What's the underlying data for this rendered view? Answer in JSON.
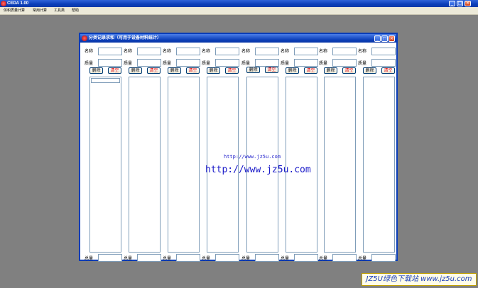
{
  "app": {
    "title": "CEDA 1.00"
  },
  "menu": [
    "体积质量计算",
    "常用计算",
    "工具类",
    "帮助"
  ],
  "dialog": {
    "title": "分类记录求和（可用于设备材料统计）",
    "columns": [
      {
        "name_label": "名称",
        "name_value": "",
        "mass_label": "质量",
        "mass_value": "",
        "delete_label": "删除",
        "clear_label": "清空",
        "total_label": "总量",
        "total_value": "",
        "has_selection": true
      },
      {
        "name_label": "名称",
        "name_value": "",
        "mass_label": "质量",
        "mass_value": "",
        "delete_label": "删除",
        "clear_label": "清空",
        "total_label": "总量",
        "total_value": "",
        "has_selection": false
      },
      {
        "name_label": "名称",
        "name_value": "",
        "mass_label": "质量",
        "mass_value": "",
        "delete_label": "删除",
        "clear_label": "清空",
        "total_label": "总量",
        "total_value": "",
        "has_selection": false
      },
      {
        "name_label": "名称",
        "name_value": "",
        "mass_label": "质量",
        "mass_value": "",
        "delete_label": "删除",
        "clear_label": "清空",
        "total_label": "总量",
        "total_value": "",
        "has_selection": false
      },
      {
        "name_label": "名称",
        "name_value": "",
        "mass_label": "质量",
        "mass_value": "",
        "delete_label": "删除",
        "clear_label": "清空",
        "total_label": "总量",
        "total_value": "",
        "has_selection": false
      },
      {
        "name_label": "名称",
        "name_value": "",
        "mass_label": "质量",
        "mass_value": "",
        "delete_label": "删除",
        "clear_label": "清空",
        "total_label": "总量",
        "total_value": "",
        "has_selection": false
      },
      {
        "name_label": "名称",
        "name_value": "",
        "mass_label": "质量",
        "mass_value": "",
        "delete_label": "删除",
        "clear_label": "清空",
        "total_label": "总量",
        "total_value": "",
        "has_selection": false
      },
      {
        "name_label": "名称",
        "name_value": "",
        "mass_label": "质量",
        "mass_value": "",
        "delete_label": "删除",
        "clear_label": "清空",
        "total_label": "总量",
        "total_value": "",
        "has_selection": false
      }
    ]
  },
  "watermark": {
    "small": "http://www.jz5u.com",
    "large": "http://www.jz5u.com"
  },
  "badge": "JZ5U绿色下载站 www.jz5u.com"
}
